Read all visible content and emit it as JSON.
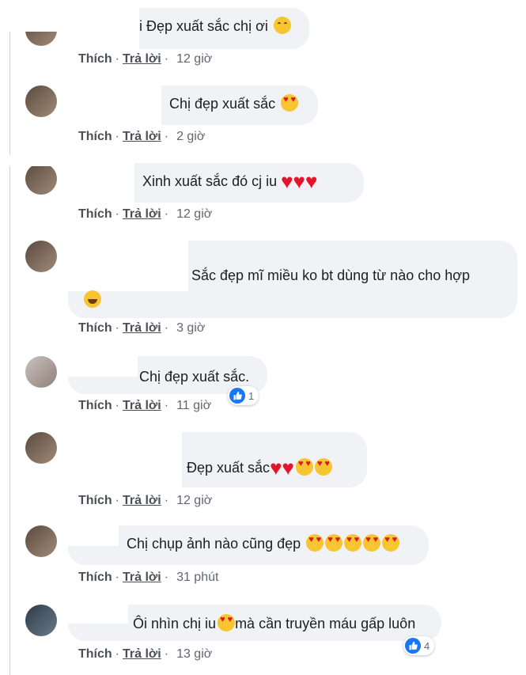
{
  "actions": {
    "like": "Thích",
    "separator": "·",
    "reply": "Trả lời"
  },
  "comments": [
    {
      "text": "i Đẹp xuất sắc chị ơi ",
      "emoji": [
        "smiling-face-icon"
      ],
      "time": "12 giờ"
    },
    {
      "text": "Chị đẹp xuất sắc ",
      "emoji": [
        "heart-eyes-icon"
      ],
      "time": "2 giờ"
    },
    {
      "text": "Xinh xuất sắc đó cj iu ",
      "emoji": [
        "red-heart-icon",
        "red-heart-icon",
        "red-heart-icon"
      ],
      "time": "12 giờ"
    },
    {
      "text": "Sắc đẹp mĩ miều ko bt dùng từ nào cho hợp",
      "emoji": [
        "rolling-laugh-icon"
      ],
      "time": "3 giờ"
    },
    {
      "text": "Chị đẹp xuất sắc.",
      "emoji": [],
      "time": "11 giờ",
      "reaction_count": "1"
    },
    {
      "text": "Đẹp xuất sắc",
      "emoji": [
        "red-heart-icon",
        "red-heart-icon",
        "heart-eyes-icon",
        "heart-eyes-icon"
      ],
      "time": "12 giờ"
    },
    {
      "text": "Chị chụp ảnh nào cũng đẹp ",
      "emoji": [
        "heart-eyes-icon",
        "heart-eyes-icon",
        "heart-eyes-icon",
        "heart-eyes-icon",
        "heart-eyes-icon"
      ],
      "time": "31 phút"
    },
    {
      "text": "Ôi nhìn chị iu",
      "emoji_inline": "heart-eyes-icon",
      "text_after": "mà cần truyền máu gấp luôn",
      "time": "13 giờ",
      "reaction_count": "4"
    }
  ]
}
